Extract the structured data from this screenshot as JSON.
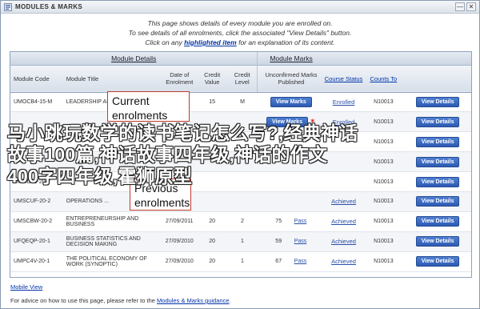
{
  "window": {
    "title": "MODULES & MARKS",
    "buttons": [
      "—",
      "✕"
    ]
  },
  "intro": {
    "line1": "This page shows details of every module you are enrolled on.",
    "line2": "To see details of all enrolments, click the associated \"View Details\" button.",
    "line3_pre": "Click on any ",
    "line3_link": "highlighted item",
    "line3_post": " for an explanation of its content."
  },
  "groups": {
    "details": "Module Details",
    "marks": "Module Marks"
  },
  "headers": {
    "code": "Module Code",
    "title": "Module Title",
    "date": "Date of Enrolment",
    "credit_value": "Credit Value",
    "credit_level": "Credit Level",
    "unconfirmed": "Unconfirmed Marks Published",
    "course_status": "Course Status",
    "counts_to": "Counts To"
  },
  "rows": [
    {
      "code": "UMOCB4-15-M",
      "title": "LEADERSHIP AND ...",
      "date": "",
      "value": "15",
      "level": "M",
      "marks": "View Marks",
      "status": "Enrolled",
      "counts": "N10013",
      "details": "View Details"
    },
    {
      "code": "",
      "title": "",
      "date": "",
      "value": "",
      "level": "",
      "marks": "View Marks",
      "status": "Enrolled",
      "counts": "N10013",
      "details": "View Details"
    },
    {
      "code": "",
      "title": "",
      "date": "",
      "value": "",
      "level": "",
      "marks": "",
      "status": "",
      "counts": "N10013",
      "details": "View Details"
    },
    {
      "code": "",
      "title": "",
      "date": "",
      "value": "",
      "level": "",
      "marks": "",
      "status": "",
      "counts": "N10013",
      "details": "View Details"
    },
    {
      "code": "UMMD39-20-2",
      "title": "",
      "date": "",
      "value": "",
      "level": "",
      "marks": "",
      "status": "",
      "counts": "N10013",
      "details": "View Details"
    },
    {
      "code": "UMSCUF-20-2",
      "title": "OPERATIONS ...",
      "date": "",
      "value": "",
      "level": "",
      "marks": "",
      "status": "Achieved",
      "counts": "N10013",
      "details": "View Details"
    },
    {
      "code": "UMSCBW-20-2",
      "title": "ENTREPRENEURSHIP AND BUSINESS",
      "date": "27/09/2011",
      "value": "20",
      "level": "2",
      "marks": "75",
      "marks_status": "Pass",
      "status": "Achieved",
      "counts": "N10013",
      "details": "View Details"
    },
    {
      "code": "UFQEQP-20-1",
      "title": "BUSINESS STATISTICS AND DECISION MAKING",
      "date": "27/09/2010",
      "value": "20",
      "level": "1",
      "marks": "59",
      "marks_status": "Pass",
      "status": "Achieved",
      "counts": "N10013",
      "details": "View Details"
    },
    {
      "code": "UMPC4V-20-1",
      "title": "THE POLITICAL ECONOMY OF WORK (SYNOPTIC)",
      "date": "27/09/2010",
      "value": "20",
      "level": "1",
      "marks": "67",
      "marks_status": "Pass",
      "status": "Achieved",
      "counts": "N10013",
      "details": "View Details"
    }
  ],
  "mobile_link": "Mobile View",
  "footer": {
    "pre": "For advice on how to use this page, please refer to the ",
    "link": "Modules & Marks guidance",
    "post": "."
  },
  "callouts": {
    "current": [
      "Current",
      "enrolments"
    ],
    "previous": [
      "Previous",
      "enrolments"
    ]
  },
  "watermark": [
    "马小跳玩数学的读书笔记怎么写?,经典神话",
    "故事100篇,神话故事四年级,神话的作文",
    "400字四年级,霍狮原型"
  ],
  "colors": {
    "button": "#2d5bb3",
    "callout_border": "#c0392b",
    "link": "#0033aa"
  }
}
